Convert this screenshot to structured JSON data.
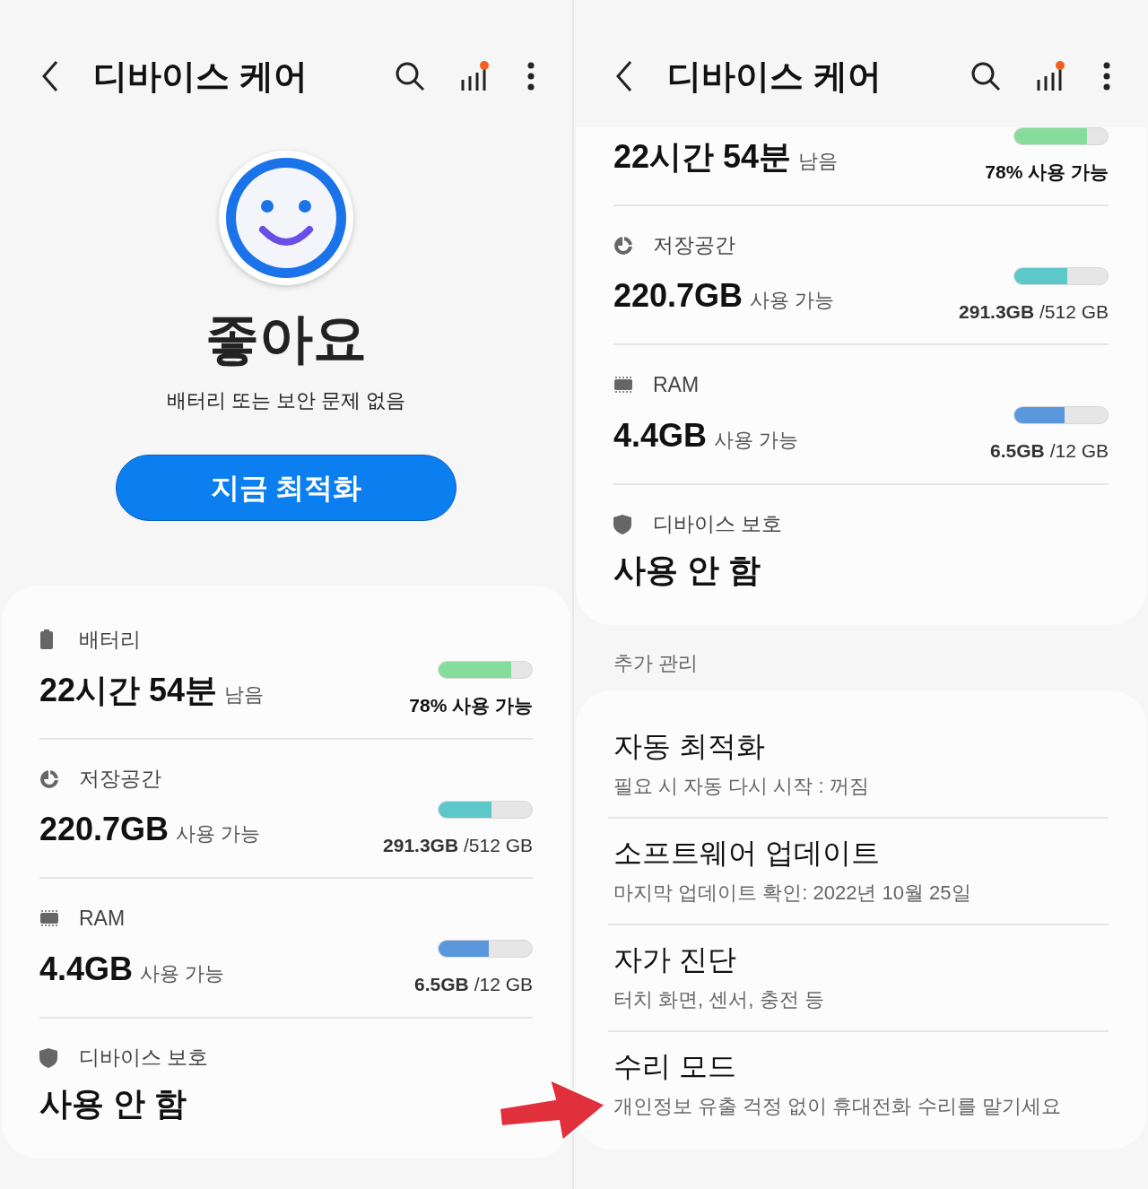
{
  "left_panel": {
    "header": {
      "title": "디바이스 케어"
    },
    "status": {
      "title": "좋아요",
      "subtitle": "배터리 또는 보안 문제 없음"
    },
    "optimize_button": "지금 최적화",
    "card": {
      "rows": [
        {
          "kind": "battery",
          "label": "배터리",
          "value": "22시간 54분",
          "unit": "남음",
          "level": 0.78,
          "color": "#86dc9a",
          "detail": "78% 사용 가능"
        },
        {
          "kind": "storage",
          "label": "저장공간",
          "value": "220.7GB",
          "unit": "사용 가능",
          "level": 0.57,
          "color": "#5cc8ca",
          "detail": "**291.3GB** /512 GB"
        },
        {
          "kind": "ram",
          "label": "RAM",
          "value": "4.4GB",
          "unit": "사용 가능",
          "level": 0.54,
          "color": "#5b97dd",
          "detail": "**6.5GB** /12 GB"
        },
        {
          "kind": "protection",
          "label": "디바이스 보호",
          "value": "사용 안 함"
        }
      ]
    }
  },
  "right_panel": {
    "header": {
      "title": "디바이스 케어"
    },
    "card": {
      "rows": [
        {
          "kind": "battery",
          "value": "22시간 54분",
          "unit": "남음",
          "level": 0.78,
          "color": "#86dc9a",
          "detail": "78% 사용 가능"
        },
        {
          "kind": "storage",
          "label": "저장공간",
          "value": "220.7GB",
          "unit": "사용 가능",
          "level": 0.57,
          "color": "#5cc8ca",
          "detail": "**291.3GB** /512 GB"
        },
        {
          "kind": "ram",
          "label": "RAM",
          "value": "4.4GB",
          "unit": "사용 가능",
          "level": 0.54,
          "color": "#5b97dd",
          "detail": "**6.5GB** /12 GB"
        },
        {
          "kind": "protection",
          "label": "디바이스 보호",
          "value": "사용 안 함"
        }
      ]
    },
    "section_title": "추가 관리",
    "menu": [
      {
        "title": "자동 최적화",
        "subtitle": "필요 시 자동 다시 시작 : 꺼짐"
      },
      {
        "title": "소프트웨어 업데이트",
        "subtitle": "마지막 업데이트 확인: 2022년 10월 25일"
      },
      {
        "title": "자가 진단",
        "subtitle": "터치 화면, 센서, 충전 등"
      },
      {
        "title": "수리 모드",
        "subtitle": "개인정보 유출 걱정 없이 휴대전화 수리를 맡기세요"
      }
    ]
  }
}
